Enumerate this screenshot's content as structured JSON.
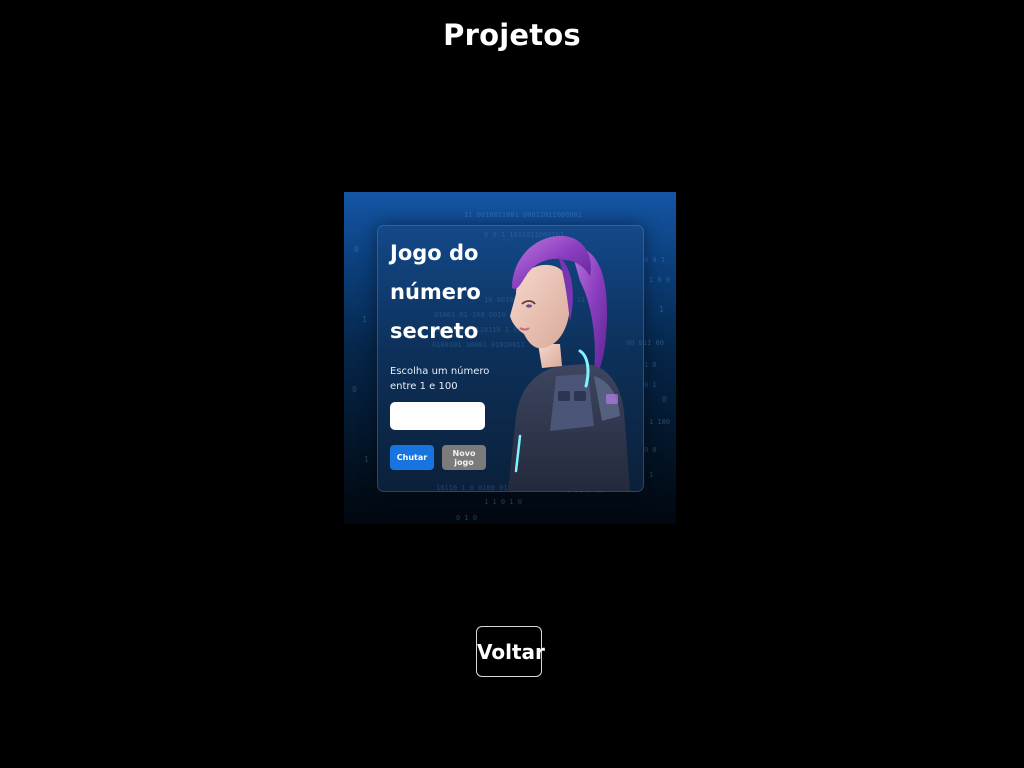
{
  "header": {
    "title": "Projetos"
  },
  "project": {
    "game_title": "Jogo do número secreto",
    "instruction": "Escolha um número entre 1 e 100",
    "input_value": "",
    "guess_button_label": "Chutar",
    "new_game_button_label": "Novo jogo",
    "background_icon": "binary-code-rain",
    "character_icon": "sci-fi-girl-illustration"
  },
  "footer": {
    "back_button_label": "Voltar"
  },
  "colors": {
    "background": "#000000",
    "primary_button": "#1875e0",
    "secondary_button": "#7b7b7b",
    "card_top": "#1556a6",
    "card_bottom": "#02070f",
    "text": "#ffffff"
  }
}
